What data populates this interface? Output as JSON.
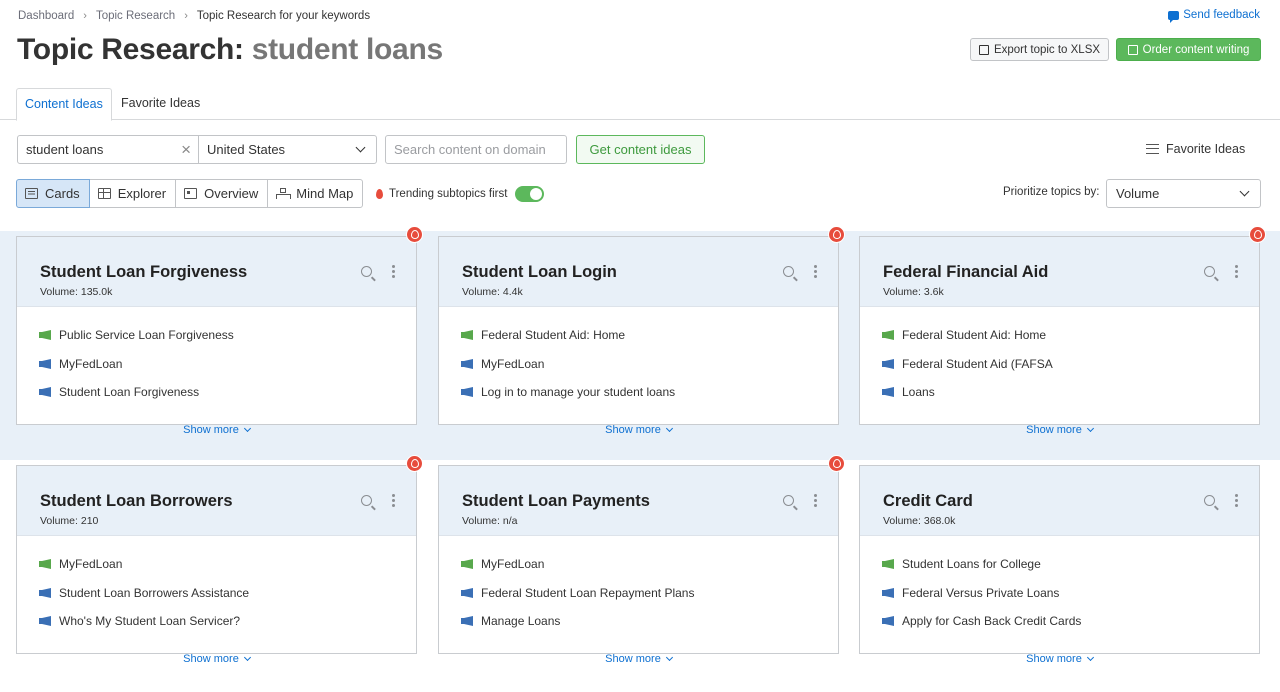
{
  "breadcrumb": [
    "Dashboard",
    "Topic Research",
    "Topic Research for your keywords"
  ],
  "feedback": "Send feedback",
  "title": {
    "prefix": "Topic Research:",
    "keyword": "student loans"
  },
  "actions": {
    "export": "Export topic to XLSX",
    "order": "Order content writing"
  },
  "tabs": [
    "Content Ideas",
    "Favorite Ideas"
  ],
  "search": {
    "keyword": "student loans",
    "country": "United States",
    "domain_placeholder": "Search content on domain",
    "button": "Get content ideas"
  },
  "favorite_ideas": "Favorite Ideas",
  "views": [
    "Cards",
    "Explorer",
    "Overview",
    "Mind Map"
  ],
  "trending": "Trending subtopics first",
  "prioritize": {
    "label": "Prioritize topics by:",
    "value": "Volume"
  },
  "show_more": "Show more",
  "cards": [
    {
      "title": "Student Loan Forgiveness",
      "volume": "Volume:  135.0k",
      "items": [
        "Public Service Loan Forgiveness",
        "MyFedLoan",
        "Student Loan Forgiveness"
      ]
    },
    {
      "title": "Student Loan Login",
      "volume": "Volume:  4.4k",
      "items": [
        "Federal Student Aid: Home",
        "MyFedLoan",
        "Log in to manage your student loans"
      ]
    },
    {
      "title": "Federal Financial Aid",
      "volume": "Volume:  3.6k",
      "items": [
        "Federal Student Aid: Home",
        "Federal Student Aid (FAFSA",
        "Loans"
      ]
    },
    {
      "title": "Student Loan Borrowers",
      "volume": "Volume:  210",
      "items": [
        "MyFedLoan",
        "Student Loan Borrowers Assistance",
        "Who's My Student Loan Servicer?"
      ]
    },
    {
      "title": "Student Loan Payments",
      "volume": "Volume:  n/a",
      "items": [
        "MyFedLoan",
        "Federal Student Loan Repayment Plans",
        "Manage Loans"
      ]
    },
    {
      "title": "Credit Card",
      "volume": "Volume:  368.0k",
      "items": [
        "Student Loans for College",
        "Federal Versus Private Loans",
        "Apply for Cash Back Credit Cards"
      ]
    }
  ]
}
